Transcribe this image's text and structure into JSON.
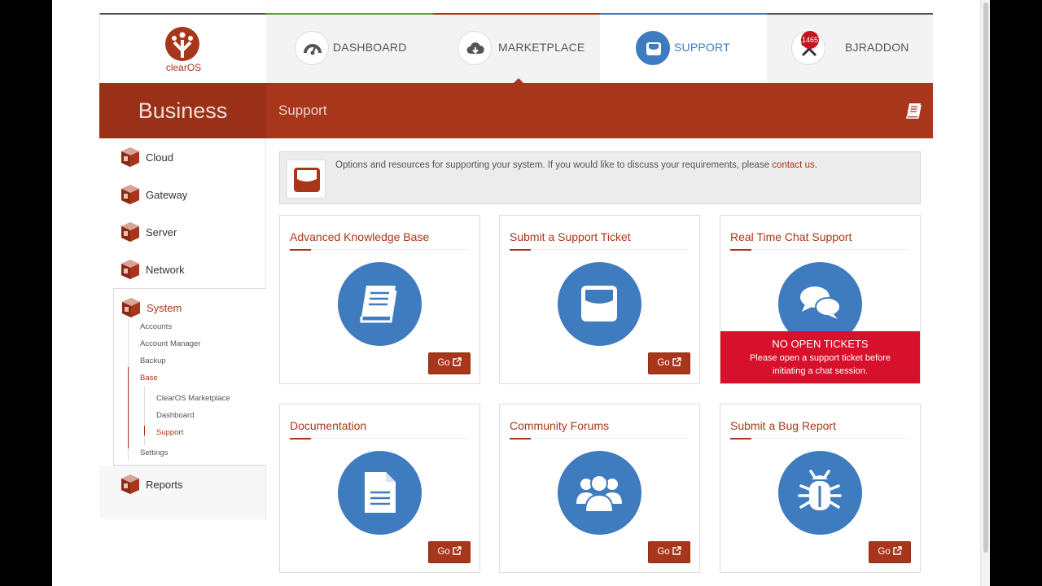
{
  "brand": {
    "logo_text": "clearOS",
    "edition": "Business"
  },
  "nav": {
    "tabs": [
      {
        "label": "DASHBOARD",
        "icon": "speedometer-icon",
        "accent": "#5a9f2c"
      },
      {
        "label": "MARKETPLACE",
        "icon": "cloud-download-icon",
        "accent": "#a8361b"
      },
      {
        "label": "SUPPORT",
        "icon": "inbox-icon",
        "accent": "#3f7bbf",
        "active": true
      },
      {
        "label": "BJRADDON",
        "icon": "tools-icon",
        "accent": "#555555",
        "badge": "1465"
      }
    ]
  },
  "page": {
    "title": "Support",
    "help_icon": "book-icon"
  },
  "sidebar": {
    "items": [
      "Cloud",
      "Gateway",
      "Server",
      "Network",
      "System",
      "Reports"
    ],
    "system_children": [
      "Accounts",
      "Account Manager",
      "Backup",
      "Base",
      "Settings"
    ],
    "base_children": [
      "ClearOS Marketplace",
      "Dashboard",
      "Support"
    ]
  },
  "intro": {
    "text": "Options and resources for supporting your system. If you would like to discuss your requirements, please ",
    "link": "contact us",
    "suffix": "."
  },
  "cards": [
    {
      "title": "Advanced Knowledge Base",
      "icon": "book-icon",
      "button": "Go"
    },
    {
      "title": "Submit a Support Ticket",
      "icon": "inbox-icon",
      "button": "Go"
    },
    {
      "title": "Real Time Chat Support",
      "icon": "chat-bubbles-icon",
      "alert_title": "NO OPEN TICKETS",
      "alert_text": "Please open a support ticket before initiating a chat session."
    },
    {
      "title": "Documentation",
      "icon": "document-icon",
      "button": "Go"
    },
    {
      "title": "Community Forums",
      "icon": "users-icon",
      "button": "Go"
    },
    {
      "title": "Submit a Bug Report",
      "icon": "bug-icon",
      "button": "Go"
    }
  ],
  "colors": {
    "brand": "#a8361b",
    "accent_blue": "#3f7bbf",
    "alert": "#d7102b"
  }
}
